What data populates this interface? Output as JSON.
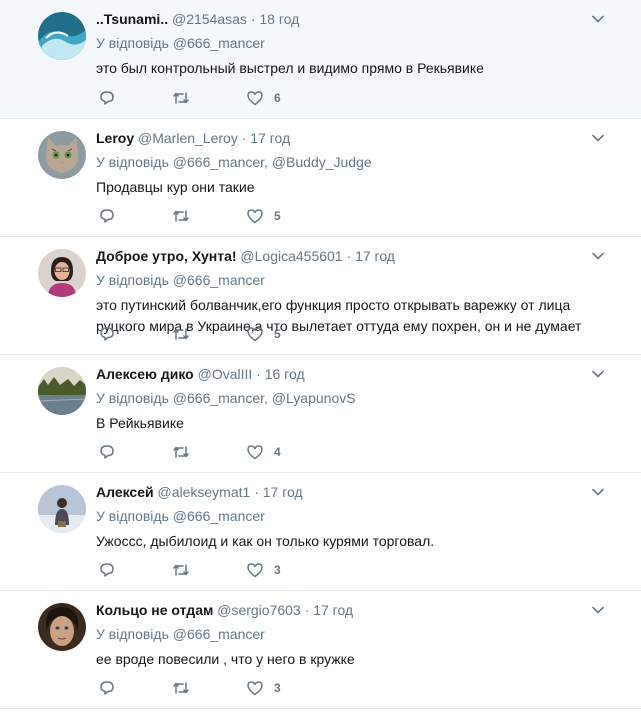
{
  "reply_prefix": "У відповідь",
  "tweets": [
    {
      "name": "..Tsunami..",
      "handle": "@2154asas",
      "time": "18 год",
      "mentions": "@666_mancer",
      "text": "это был контрольный выстрел и видимо прямо в Рекьявике",
      "likes": "6",
      "avatar": "wave"
    },
    {
      "name": "Leroy",
      "handle": "@Marlen_Leroy",
      "time": "17 год",
      "mentions": "@666_mancer, @Buddy_Judge",
      "text": "Продавцы кур они такие",
      "likes": "5",
      "avatar": "cat"
    },
    {
      "name": "Доброе утро, Хунта!",
      "handle": "@Logica455601",
      "time": "17 год",
      "mentions": "@666_mancer",
      "text": "это путинский болванчик,его функция просто открывать варежку от лица руцкого мира в Украине,а что вылетает оттуда ему похрен, он и не думает",
      "likes": "5",
      "avatar": "woman"
    },
    {
      "name": "Алексею дико",
      "handle": "@OvalIII",
      "time": "16 год",
      "mentions": "@666_mancer, @LyapunovS",
      "text": "В Рейкьявике",
      "likes": "4",
      "avatar": "landscape"
    },
    {
      "name": "Алексей",
      "handle": "@alekseymat1",
      "time": "17 год",
      "mentions": "@666_mancer",
      "text": "Ужоссс, дыбилоид и как он только курями торговал.",
      "likes": "3",
      "avatar": "snow"
    },
    {
      "name": "Кольцо не отдам",
      "handle": "@sergio7603",
      "time": "17 год",
      "mentions": "@666_mancer",
      "text": "ее вроде повесили , что у него в кружке",
      "likes": "3",
      "avatar": "face"
    }
  ]
}
